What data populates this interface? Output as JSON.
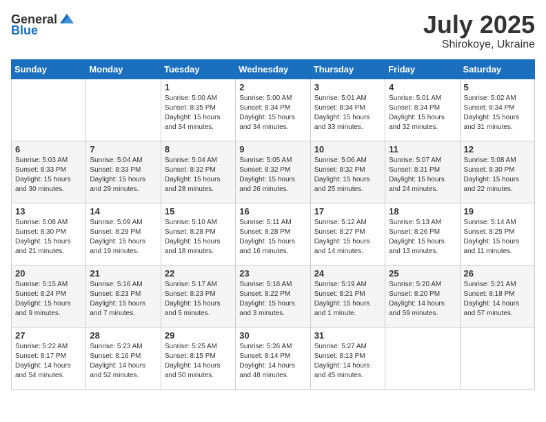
{
  "logo": {
    "general": "General",
    "blue": "Blue"
  },
  "title": "July 2025",
  "subtitle": "Shirokoye, Ukraine",
  "headers": [
    "Sunday",
    "Monday",
    "Tuesday",
    "Wednesday",
    "Thursday",
    "Friday",
    "Saturday"
  ],
  "weeks": [
    [
      {
        "day": "",
        "sunrise": "",
        "sunset": "",
        "daylight": ""
      },
      {
        "day": "",
        "sunrise": "",
        "sunset": "",
        "daylight": ""
      },
      {
        "day": "1",
        "sunrise": "Sunrise: 5:00 AM",
        "sunset": "Sunset: 8:35 PM",
        "daylight": "Daylight: 15 hours and 34 minutes."
      },
      {
        "day": "2",
        "sunrise": "Sunrise: 5:00 AM",
        "sunset": "Sunset: 8:34 PM",
        "daylight": "Daylight: 15 hours and 34 minutes."
      },
      {
        "day": "3",
        "sunrise": "Sunrise: 5:01 AM",
        "sunset": "Sunset: 8:34 PM",
        "daylight": "Daylight: 15 hours and 33 minutes."
      },
      {
        "day": "4",
        "sunrise": "Sunrise: 5:01 AM",
        "sunset": "Sunset: 8:34 PM",
        "daylight": "Daylight: 15 hours and 32 minutes."
      },
      {
        "day": "5",
        "sunrise": "Sunrise: 5:02 AM",
        "sunset": "Sunset: 8:34 PM",
        "daylight": "Daylight: 15 hours and 31 minutes."
      }
    ],
    [
      {
        "day": "6",
        "sunrise": "Sunrise: 5:03 AM",
        "sunset": "Sunset: 8:33 PM",
        "daylight": "Daylight: 15 hours and 30 minutes."
      },
      {
        "day": "7",
        "sunrise": "Sunrise: 5:04 AM",
        "sunset": "Sunset: 8:33 PM",
        "daylight": "Daylight: 15 hours and 29 minutes."
      },
      {
        "day": "8",
        "sunrise": "Sunrise: 5:04 AM",
        "sunset": "Sunset: 8:32 PM",
        "daylight": "Daylight: 15 hours and 28 minutes."
      },
      {
        "day": "9",
        "sunrise": "Sunrise: 5:05 AM",
        "sunset": "Sunset: 8:32 PM",
        "daylight": "Daylight: 15 hours and 26 minutes."
      },
      {
        "day": "10",
        "sunrise": "Sunrise: 5:06 AM",
        "sunset": "Sunset: 8:32 PM",
        "daylight": "Daylight: 15 hours and 25 minutes."
      },
      {
        "day": "11",
        "sunrise": "Sunrise: 5:07 AM",
        "sunset": "Sunset: 8:31 PM",
        "daylight": "Daylight: 15 hours and 24 minutes."
      },
      {
        "day": "12",
        "sunrise": "Sunrise: 5:08 AM",
        "sunset": "Sunset: 8:30 PM",
        "daylight": "Daylight: 15 hours and 22 minutes."
      }
    ],
    [
      {
        "day": "13",
        "sunrise": "Sunrise: 5:08 AM",
        "sunset": "Sunset: 8:30 PM",
        "daylight": "Daylight: 15 hours and 21 minutes."
      },
      {
        "day": "14",
        "sunrise": "Sunrise: 5:09 AM",
        "sunset": "Sunset: 8:29 PM",
        "daylight": "Daylight: 15 hours and 19 minutes."
      },
      {
        "day": "15",
        "sunrise": "Sunrise: 5:10 AM",
        "sunset": "Sunset: 8:28 PM",
        "daylight": "Daylight: 15 hours and 18 minutes."
      },
      {
        "day": "16",
        "sunrise": "Sunrise: 5:11 AM",
        "sunset": "Sunset: 8:28 PM",
        "daylight": "Daylight: 15 hours and 16 minutes."
      },
      {
        "day": "17",
        "sunrise": "Sunrise: 5:12 AM",
        "sunset": "Sunset: 8:27 PM",
        "daylight": "Daylight: 15 hours and 14 minutes."
      },
      {
        "day": "18",
        "sunrise": "Sunrise: 5:13 AM",
        "sunset": "Sunset: 8:26 PM",
        "daylight": "Daylight: 15 hours and 13 minutes."
      },
      {
        "day": "19",
        "sunrise": "Sunrise: 5:14 AM",
        "sunset": "Sunset: 8:25 PM",
        "daylight": "Daylight: 15 hours and 11 minutes."
      }
    ],
    [
      {
        "day": "20",
        "sunrise": "Sunrise: 5:15 AM",
        "sunset": "Sunset: 8:24 PM",
        "daylight": "Daylight: 15 hours and 9 minutes."
      },
      {
        "day": "21",
        "sunrise": "Sunrise: 5:16 AM",
        "sunset": "Sunset: 8:23 PM",
        "daylight": "Daylight: 15 hours and 7 minutes."
      },
      {
        "day": "22",
        "sunrise": "Sunrise: 5:17 AM",
        "sunset": "Sunset: 8:23 PM",
        "daylight": "Daylight: 15 hours and 5 minutes."
      },
      {
        "day": "23",
        "sunrise": "Sunrise: 5:18 AM",
        "sunset": "Sunset: 8:22 PM",
        "daylight": "Daylight: 15 hours and 3 minutes."
      },
      {
        "day": "24",
        "sunrise": "Sunrise: 5:19 AM",
        "sunset": "Sunset: 8:21 PM",
        "daylight": "Daylight: 15 hours and 1 minute."
      },
      {
        "day": "25",
        "sunrise": "Sunrise: 5:20 AM",
        "sunset": "Sunset: 8:20 PM",
        "daylight": "Daylight: 14 hours and 59 minutes."
      },
      {
        "day": "26",
        "sunrise": "Sunrise: 5:21 AM",
        "sunset": "Sunset: 8:18 PM",
        "daylight": "Daylight: 14 hours and 57 minutes."
      }
    ],
    [
      {
        "day": "27",
        "sunrise": "Sunrise: 5:22 AM",
        "sunset": "Sunset: 8:17 PM",
        "daylight": "Daylight: 14 hours and 54 minutes."
      },
      {
        "day": "28",
        "sunrise": "Sunrise: 5:23 AM",
        "sunset": "Sunset: 8:16 PM",
        "daylight": "Daylight: 14 hours and 52 minutes."
      },
      {
        "day": "29",
        "sunrise": "Sunrise: 5:25 AM",
        "sunset": "Sunset: 8:15 PM",
        "daylight": "Daylight: 14 hours and 50 minutes."
      },
      {
        "day": "30",
        "sunrise": "Sunrise: 5:26 AM",
        "sunset": "Sunset: 8:14 PM",
        "daylight": "Daylight: 14 hours and 48 minutes."
      },
      {
        "day": "31",
        "sunrise": "Sunrise: 5:27 AM",
        "sunset": "Sunset: 8:13 PM",
        "daylight": "Daylight: 14 hours and 45 minutes."
      },
      {
        "day": "",
        "sunrise": "",
        "sunset": "",
        "daylight": ""
      },
      {
        "day": "",
        "sunrise": "",
        "sunset": "",
        "daylight": ""
      }
    ]
  ]
}
